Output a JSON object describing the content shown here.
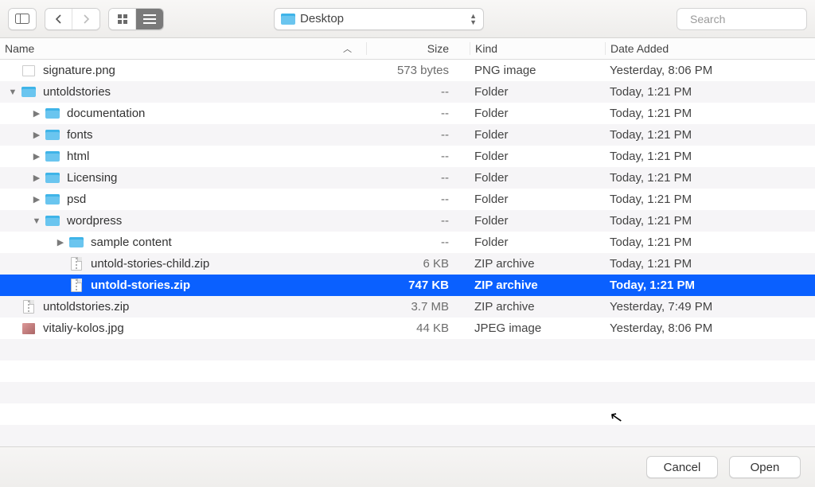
{
  "toolbar": {
    "location_label": "Desktop",
    "search_placeholder": "Search"
  },
  "columns": {
    "name": "Name",
    "size": "Size",
    "kind": "Kind",
    "date": "Date Added"
  },
  "rows": [
    {
      "indent": 0,
      "disclosure": "",
      "icon": "png",
      "name": "signature.png",
      "size": "573 bytes",
      "kind": "PNG image",
      "date": "Yesterday, 8:06 PM",
      "selected": false
    },
    {
      "indent": 0,
      "disclosure": "down",
      "icon": "folder",
      "name": "untoldstories",
      "size": "--",
      "kind": "Folder",
      "date": "Today, 1:21 PM",
      "selected": false
    },
    {
      "indent": 1,
      "disclosure": "right",
      "icon": "folder",
      "name": "documentation",
      "size": "--",
      "kind": "Folder",
      "date": "Today, 1:21 PM",
      "selected": false
    },
    {
      "indent": 1,
      "disclosure": "right",
      "icon": "folder",
      "name": "fonts",
      "size": "--",
      "kind": "Folder",
      "date": "Today, 1:21 PM",
      "selected": false
    },
    {
      "indent": 1,
      "disclosure": "right",
      "icon": "folder",
      "name": "html",
      "size": "--",
      "kind": "Folder",
      "date": "Today, 1:21 PM",
      "selected": false
    },
    {
      "indent": 1,
      "disclosure": "right",
      "icon": "folder",
      "name": "Licensing",
      "size": "--",
      "kind": "Folder",
      "date": "Today, 1:21 PM",
      "selected": false
    },
    {
      "indent": 1,
      "disclosure": "right",
      "icon": "folder",
      "name": "psd",
      "size": "--",
      "kind": "Folder",
      "date": "Today, 1:21 PM",
      "selected": false
    },
    {
      "indent": 1,
      "disclosure": "down",
      "icon": "folder",
      "name": "wordpress",
      "size": "--",
      "kind": "Folder",
      "date": "Today, 1:21 PM",
      "selected": false
    },
    {
      "indent": 2,
      "disclosure": "right",
      "icon": "folder",
      "name": "sample content",
      "size": "--",
      "kind": "Folder",
      "date": "Today, 1:21 PM",
      "selected": false
    },
    {
      "indent": 2,
      "disclosure": "",
      "icon": "zip",
      "name": "untold-stories-child.zip",
      "size": "6 KB",
      "kind": "ZIP archive",
      "date": "Today, 1:21 PM",
      "selected": false
    },
    {
      "indent": 2,
      "disclosure": "",
      "icon": "zip",
      "name": "untold-stories.zip",
      "size": "747 KB",
      "kind": "ZIP archive",
      "date": "Today, 1:21 PM",
      "selected": true
    },
    {
      "indent": 0,
      "disclosure": "",
      "icon": "zip",
      "name": "untoldstories.zip",
      "size": "3.7 MB",
      "kind": "ZIP archive",
      "date": "Yesterday, 7:49 PM",
      "selected": false
    },
    {
      "indent": 0,
      "disclosure": "",
      "icon": "jpg",
      "name": "vitaliy-kolos.jpg",
      "size": "44 KB",
      "kind": "JPEG image",
      "date": "Yesterday, 8:06 PM",
      "selected": false
    }
  ],
  "footer": {
    "cancel": "Cancel",
    "open": "Open"
  }
}
